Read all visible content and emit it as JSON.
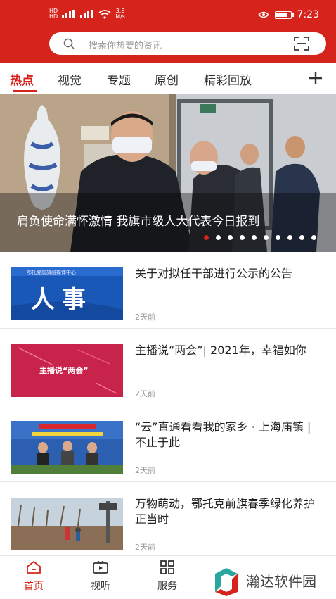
{
  "status_bar": {
    "network_top": "HD",
    "network_bottom": "HD",
    "speed_value": "3.8",
    "speed_unit": "M/s",
    "battery_level": 0.8,
    "time": "7:23"
  },
  "search": {
    "placeholder": "搜索你想要的资讯"
  },
  "tabs": [
    {
      "label": "热点",
      "active": true
    },
    {
      "label": "视觉"
    },
    {
      "label": "专题"
    },
    {
      "label": "原创"
    },
    {
      "label": "精彩回放"
    }
  ],
  "banner": {
    "caption": "肩负使命满怀激情  我旗市级人大代表今日报到",
    "slide_count": 10,
    "active_index": 0
  },
  "news": [
    {
      "title": "关于对拟任干部进行公示的公告",
      "time": "2天前",
      "thumb_text": "人事",
      "thumb_sub": "鄂托克前旗融媒体中心"
    },
    {
      "title": "主播说“两会”| 2021年，幸福如你",
      "time": "2天前",
      "thumb_text": "主播说“两会”"
    },
    {
      "title": "“云”直通看看我的家乡 · 上海庙镇 | 不止于此",
      "time": "2天前"
    },
    {
      "title": "万物萌动，鄂托克前旗春季绿化养护正当时",
      "time": "2天前"
    }
  ],
  "bottom_nav": [
    {
      "label": "首页",
      "icon": "home-icon",
      "active": true
    },
    {
      "label": "视听",
      "icon": "tv-icon"
    },
    {
      "label": "服务",
      "icon": "grid-icon"
    }
  ],
  "watermark": {
    "text": "瀚达软件园"
  },
  "colors": {
    "brand_red": "#d6241c"
  }
}
